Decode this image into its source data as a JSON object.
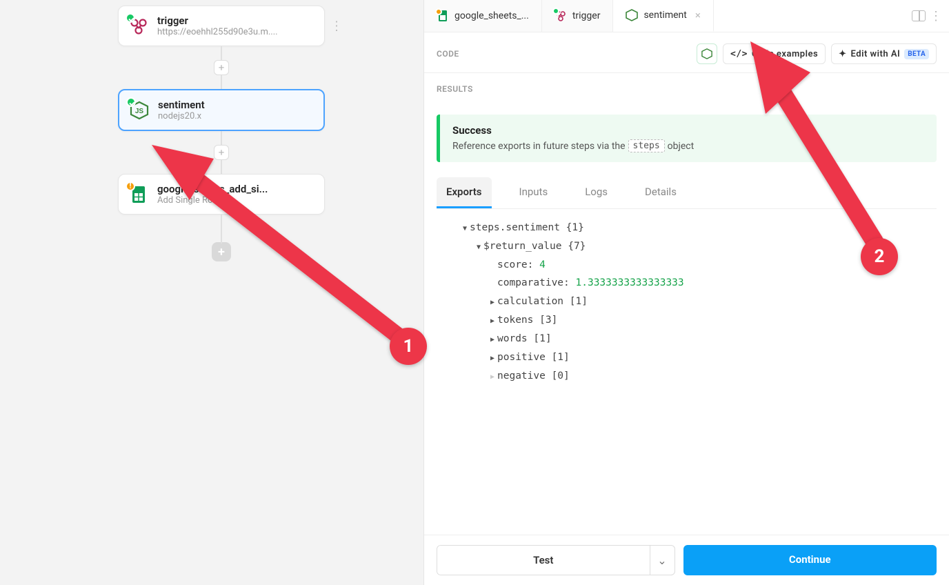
{
  "workflow": {
    "cards": [
      {
        "title": "trigger",
        "sub": "https://eoehhl255d90e3u.m....",
        "selected": false,
        "status": "check",
        "icon": "webhook"
      },
      {
        "title": "sentiment",
        "sub": "nodejs20.x",
        "selected": true,
        "status": "check",
        "icon": "nodejs"
      },
      {
        "title": "google_sheets_add_si...",
        "sub": "Add Single Row",
        "selected": false,
        "status": "warn",
        "icon": "sheets"
      }
    ]
  },
  "tabs": [
    {
      "label": "google_sheets_...",
      "icon": "sheets",
      "status": "dot"
    },
    {
      "label": "trigger",
      "icon": "webhook",
      "status": "check"
    },
    {
      "label": "sentiment",
      "icon": "nodejs",
      "active": true,
      "closable": true
    }
  ],
  "sections": {
    "code": "CODE",
    "results": "RESULTS"
  },
  "buttons": {
    "code_examples": "Code examples",
    "edit_ai": "Edit with AI",
    "beta": "BETA",
    "test": "Test",
    "continue": "Continue"
  },
  "success": {
    "title": "Success",
    "prefix": "Reference exports in future steps via the",
    "chip": "steps",
    "suffix": "object"
  },
  "result_tabs": [
    "Exports",
    "Inputs",
    "Logs",
    "Details"
  ],
  "tree": {
    "root": "steps.sentiment {1}",
    "ret": "$return_value {7}",
    "rows": [
      {
        "k": "score:",
        "v": "4",
        "leaf": true
      },
      {
        "k": "comparative:",
        "v": "1.3333333333333333",
        "leaf": true
      },
      {
        "k": "calculation [1]"
      },
      {
        "k": "tokens [3]"
      },
      {
        "k": "words [1]"
      },
      {
        "k": "positive [1]"
      },
      {
        "k": "negative [0]",
        "muted": true
      }
    ]
  },
  "annotations": {
    "one": "1",
    "two": "2"
  }
}
